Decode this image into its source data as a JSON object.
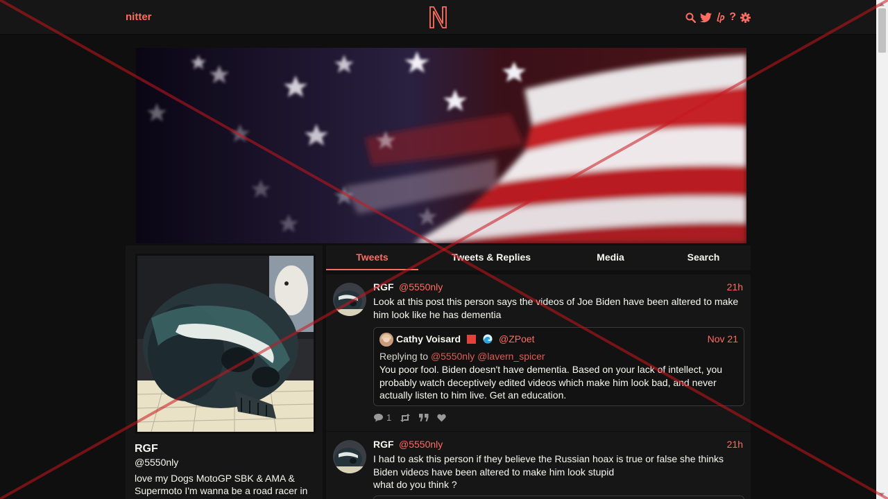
{
  "nav": {
    "brand": "nitter",
    "icons": [
      "search-icon",
      "twitter-icon",
      "liberapay-icon",
      "help-icon",
      "gear-icon"
    ],
    "accent": "#ff6c60"
  },
  "profile": {
    "fullname": "RGF",
    "username": "@5550nly",
    "bio": "love my Dogs MotoGP SBK & AMA & Supermoto I'm wanna be a road racer in"
  },
  "tabs": [
    {
      "label": "Tweets",
      "active": true
    },
    {
      "label": "Tweets & Replies",
      "active": false
    },
    {
      "label": "Media",
      "active": false
    },
    {
      "label": "Search",
      "active": false
    }
  ],
  "tweets": [
    {
      "fullname": "RGF",
      "username": "@5550nly",
      "date": "21h",
      "text": "Look at this post this person says the videos of Joe Biden have been altered to make him look like he has dementia",
      "quote": {
        "fullname": "Cathy Voisard",
        "username": "@ZPoet",
        "date": "Nov 21",
        "replying_to_label": "Replying to",
        "replying_to": [
          "@5550nly",
          "@lavern_spicer"
        ],
        "text": "You poor fool.  Biden doesn't have dementia.  Based on your lack of intellect, you probably watch deceptively edited videos which make him look bad, and never actually listen to him live. Get an education."
      },
      "stats": {
        "replies": "1",
        "retweets": "",
        "quotes": "",
        "likes": ""
      }
    },
    {
      "fullname": "RGF",
      "username": "@5550nly",
      "date": "21h",
      "text_lines": [
        "I had to ask this person if they believe the Russian hoax is true or false she thinks",
        "Biden videos have been altered to make him look stupid",
        "what do you think ?"
      ]
    }
  ]
}
